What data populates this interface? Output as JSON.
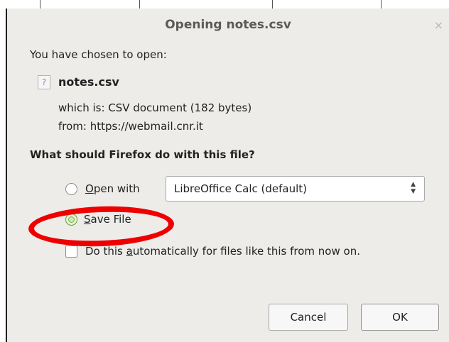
{
  "dialog": {
    "title": "Opening notes.csv",
    "close_glyph": "×",
    "intro": "You have chosen to open:",
    "file": {
      "name": "notes.csv",
      "icon": "unknown-file-icon",
      "type_label": "which is:",
      "type_value": "CSV document (182 bytes)",
      "from_label": "from:",
      "from_value": "https://webmail.cnr.it"
    },
    "question": "What should Firefox do with this file?",
    "options": {
      "open_with": {
        "label_prefix": "",
        "label_accel": "O",
        "label_rest": "pen with",
        "selected": false,
        "app": "LibreOffice Calc (default)"
      },
      "save_file": {
        "label_accel": "S",
        "label_rest": "ave File",
        "selected": true
      }
    },
    "auto_checkbox": {
      "label_pre": "Do this ",
      "label_accel": "a",
      "label_rest": "utomatically for files like this from now on.",
      "checked": false
    },
    "buttons": {
      "cancel": "Cancel",
      "ok": "OK"
    },
    "annotation_color": "#ee0000"
  }
}
